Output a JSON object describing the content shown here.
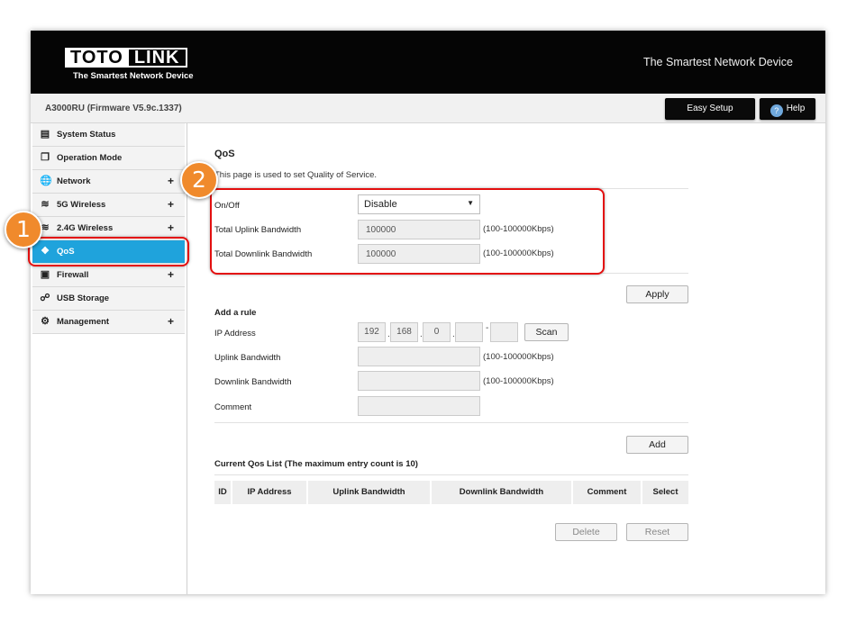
{
  "header": {
    "logo_left": "TOTO",
    "logo_right": "LINK",
    "logo_tagline": "The Smartest Network Device",
    "tagline": "The Smartest Network Device"
  },
  "subbar": {
    "firmware": "A3000RU (Firmware V5.9c.1337)",
    "easy_setup": "Easy Setup",
    "help": "Help"
  },
  "sidebar": {
    "items": [
      {
        "label": "System Status",
        "icon": "monitor-icon",
        "expand": ""
      },
      {
        "label": "Operation Mode",
        "icon": "copy-icon",
        "expand": ""
      },
      {
        "label": "Network",
        "icon": "globe-icon",
        "expand": "+"
      },
      {
        "label": "5G Wireless",
        "icon": "wifi-icon",
        "expand": "+"
      },
      {
        "label": "2.4G Wireless",
        "icon": "wifi-icon",
        "expand": "+"
      },
      {
        "label": "QoS",
        "icon": "qos-icon",
        "expand": ""
      },
      {
        "label": "Firewall",
        "icon": "lock-icon",
        "expand": "+"
      },
      {
        "label": "USB Storage",
        "icon": "usb-icon",
        "expand": ""
      },
      {
        "label": "Management",
        "icon": "gear-icon",
        "expand": "+"
      }
    ],
    "active_color": "#1fa3dc"
  },
  "qos": {
    "title": "QoS",
    "description": "This page is used to set Quality of Service.",
    "onoff_label": "On/Off",
    "onoff_value": "Disable",
    "uplink_label": "Total Uplink Bandwidth",
    "uplink_value": "100000",
    "downlink_label": "Total Downlink Bandwidth",
    "downlink_value": "100000",
    "range_hint": "(100-100000Kbps)",
    "apply": "Apply"
  },
  "rule": {
    "heading": "Add a rule",
    "ip_label": "IP Address",
    "ip": [
      "192",
      "168",
      "0"
    ],
    "dash": "-",
    "scan": "Scan",
    "uplink_label": "Uplink Bandwidth",
    "downlink_label": "Downlink Bandwidth",
    "comment_label": "Comment",
    "range_hint": "(100-100000Kbps)",
    "add": "Add"
  },
  "list": {
    "heading": "Current Qos List  (The maximum entry count is 10)",
    "columns": [
      "ID",
      "IP Address",
      "Uplink Bandwidth",
      "Downlink Bandwidth",
      "Comment",
      "Select"
    ],
    "delete": "Delete",
    "reset": "Reset"
  },
  "annotations": {
    "badge1": "1",
    "badge2": "2",
    "highlight_color": "#e30f0f",
    "badge_color": "#f08a2c"
  }
}
